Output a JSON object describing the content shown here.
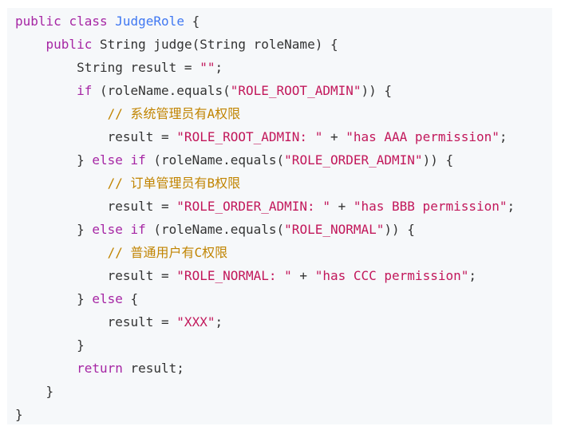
{
  "code": {
    "kw_public": "public",
    "kw_class": "class",
    "class_name": "JudgeRole",
    "brace_open": "{",
    "brace_close": "}",
    "type_string": "String",
    "method_sig": "judge(String roleName) {",
    "var_decl": "result = ",
    "empty_str": "\"\"",
    "semi": ";",
    "kw_if": "if",
    "kw_else": "else",
    "kw_return": "return",
    "equals_open": "(roleName.equals(",
    "equals_close": ")) {",
    "close_brace_else": "} ",
    "assign": "result = ",
    "plus": " + ",
    "return_val": "result;",
    "str_root": "\"ROLE_ROOT_ADMIN\"",
    "str_order": "\"ROLE_ORDER_ADMIN\"",
    "str_normal": "\"ROLE_NORMAL\"",
    "str_root_prefix": "\"ROLE_ROOT_ADMIN: \"",
    "str_order_prefix": "\"ROLE_ORDER_ADMIN: \"",
    "str_normal_prefix": "\"ROLE_NORMAL: \"",
    "str_aaa": "\"has AAA permission\"",
    "str_bbb": "\"has BBB permission\"",
    "str_ccc": "\"has CCC permission\"",
    "str_xxx": "\"XXX\"",
    "comment_a": "// 系统管理员有A权限",
    "comment_b": "// 订单管理员有B权限",
    "comment_c": "// 普通用户有C权限",
    "else_brace": " {"
  }
}
